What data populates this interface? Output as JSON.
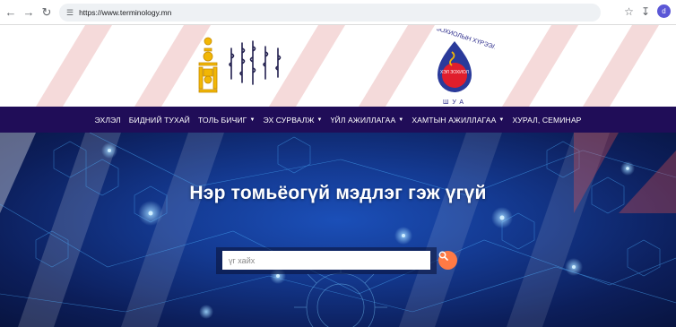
{
  "browser": {
    "url": "https://www.terminology.mn",
    "profile_initial": "d"
  },
  "header": {
    "left_logo_name": "soyombo-emblem",
    "right_logo_text": "ЗОХИОЛЫН ХҮРЭЭЛЭН",
    "right_logo_bottom": "ШУА",
    "right_logo_center": "ХЭЛ ЗОХИОЛ"
  },
  "nav": {
    "items": [
      {
        "label": "ЭХЛЭЛ",
        "dropdown": false
      },
      {
        "label": "БИДНИЙ ТУХАЙ",
        "dropdown": false
      },
      {
        "label": "ТОЛЬ БИЧИГ",
        "dropdown": true
      },
      {
        "label": "ЭХ СУРВАЛЖ",
        "dropdown": true
      },
      {
        "label": "ҮЙЛ АЖИЛЛАГАА",
        "dropdown": true
      },
      {
        "label": "ХАМТЫН АЖИЛЛАГАА",
        "dropdown": true
      },
      {
        "label": "ХУРАЛ, СЕМИНАР",
        "dropdown": false
      }
    ]
  },
  "hero": {
    "title": "Нэр томьёогүй мэдлэг гэж үгүй",
    "search_placeholder": "үг хайх"
  },
  "colors": {
    "navbar": "#200d58",
    "search_button": "#ff7a45",
    "stripes": "#e02020"
  }
}
